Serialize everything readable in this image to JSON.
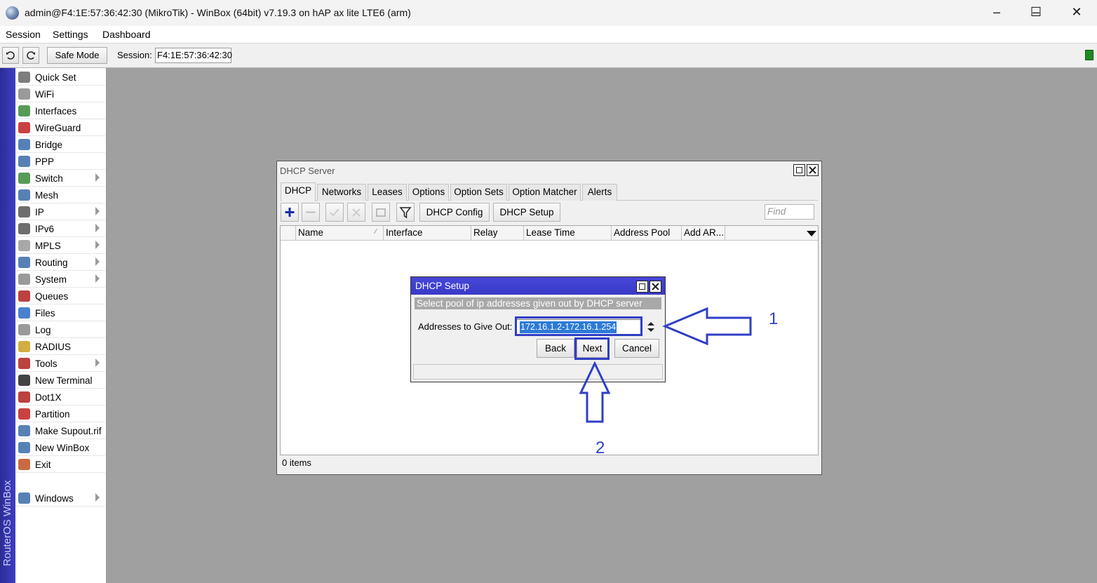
{
  "app": {
    "title": "admin@F4:1E:57:36:42:30 (MikroTik) - WinBox (64bit) v7.19.3 on hAP ax lite LTE6 (arm)",
    "side_text": "RouterOS WinBox",
    "window_controls": {
      "minimize": "–",
      "maximize": "☐",
      "close": "✕"
    }
  },
  "menu": [
    "Session",
    "Settings",
    "Dashboard"
  ],
  "toolbar": {
    "safe_mode": "Safe Mode",
    "session_label": "Session:",
    "session_value": "F4:1E:57:36:42:30"
  },
  "sidebar": {
    "items": [
      {
        "label": "Quick Set",
        "icon": "wand-icon",
        "color": "#666",
        "arrow": false
      },
      {
        "label": "WiFi",
        "icon": "wifi-icon",
        "color": "#888",
        "arrow": false
      },
      {
        "label": "Interfaces",
        "icon": "interfaces-icon",
        "color": "#3a8a3a",
        "arrow": false
      },
      {
        "label": "WireGuard",
        "icon": "wireguard-icon",
        "color": "#c02020",
        "arrow": false
      },
      {
        "label": "Bridge",
        "icon": "bridge-icon",
        "color": "#3a6aa8",
        "arrow": false
      },
      {
        "label": "PPP",
        "icon": "ppp-icon",
        "color": "#3a6aa8",
        "arrow": false
      },
      {
        "label": "Switch",
        "icon": "switch-icon",
        "color": "#3a8a3a",
        "arrow": true
      },
      {
        "label": "Mesh",
        "icon": "mesh-icon",
        "color": "#3a6aa8",
        "arrow": false
      },
      {
        "label": "IP",
        "icon": "ip-icon",
        "color": "#555",
        "arrow": true
      },
      {
        "label": "IPv6",
        "icon": "ipv6-icon",
        "color": "#555",
        "arrow": true
      },
      {
        "label": "MPLS",
        "icon": "mpls-icon",
        "color": "#999",
        "arrow": true
      },
      {
        "label": "Routing",
        "icon": "routing-icon",
        "color": "#3a6aa8",
        "arrow": true
      },
      {
        "label": "System",
        "icon": "gear-icon",
        "color": "#888",
        "arrow": true
      },
      {
        "label": "Queues",
        "icon": "queues-icon",
        "color": "#b02020",
        "arrow": false
      },
      {
        "label": "Files",
        "icon": "folder-icon",
        "color": "#2a6ac8",
        "arrow": false
      },
      {
        "label": "Log",
        "icon": "log-icon",
        "color": "#888",
        "arrow": false
      },
      {
        "label": "RADIUS",
        "icon": "radius-icon",
        "color": "#c8a020",
        "arrow": false
      },
      {
        "label": "Tools",
        "icon": "tools-icon",
        "color": "#b02020",
        "arrow": true
      },
      {
        "label": "New Terminal",
        "icon": "terminal-icon",
        "color": "#222",
        "arrow": false
      },
      {
        "label": "Dot1X",
        "icon": "dot1x-icon",
        "color": "#b02020",
        "arrow": false
      },
      {
        "label": "Partition",
        "icon": "partition-icon",
        "color": "#c02020",
        "arrow": false
      },
      {
        "label": "Make Supout.rif",
        "icon": "supout-icon",
        "color": "#3a6aa8",
        "arrow": false
      },
      {
        "label": "New WinBox",
        "icon": "winbox-icon",
        "color": "#3a6aa8",
        "arrow": false
      },
      {
        "label": "Exit",
        "icon": "exit-icon",
        "color": "#c05020",
        "arrow": false
      }
    ],
    "windows": {
      "label": "Windows",
      "icon": "windows-icon",
      "color": "#3a6aa8",
      "arrow": true
    }
  },
  "dhcp_window": {
    "title": "DHCP Server",
    "tabs": [
      "DHCP",
      "Networks",
      "Leases",
      "Options",
      "Option Sets",
      "Option Matcher",
      "Alerts"
    ],
    "active_tab": "DHCP",
    "buttons": {
      "config": "DHCP Config",
      "setup": "DHCP Setup"
    },
    "find_placeholder": "Find",
    "columns": [
      "Name",
      "Interface",
      "Relay",
      "Lease Time",
      "Address Pool",
      "Add AR..."
    ],
    "status": "0 items"
  },
  "setup_dialog": {
    "title": "DHCP Setup",
    "hint": "Select pool of ip addresses given out by DHCP server",
    "field_label": "Addresses to Give Out:",
    "field_value": "172.16.1.2-172.16.1.254",
    "buttons": {
      "back": "Back",
      "next": "Next",
      "cancel": "Cancel"
    }
  },
  "annotations": {
    "one": "1",
    "two": "2",
    "color": "#2f3fc5"
  }
}
